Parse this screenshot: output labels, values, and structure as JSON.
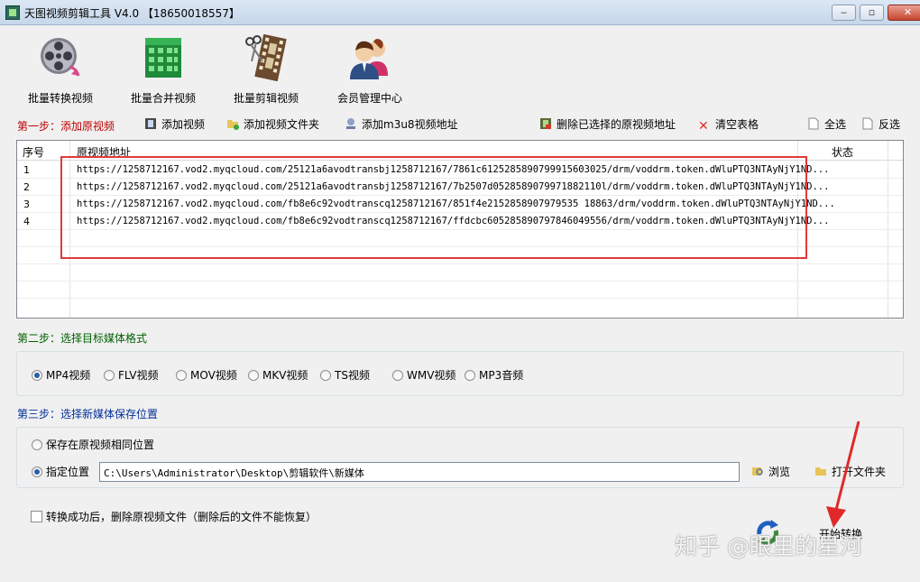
{
  "window": {
    "title": "天图视频剪辑工具 V4.0  【18650018557】",
    "min_label": "▭",
    "max_label": "□",
    "close_label": "✕"
  },
  "toolbar": {
    "items": [
      {
        "label": "批量转换视频",
        "icon": "film-reel-icon"
      },
      {
        "label": "批量合并视频",
        "icon": "building-grid-icon"
      },
      {
        "label": "批量剪辑视频",
        "icon": "film-scissors-icon"
      },
      {
        "label": "会员管理中心",
        "icon": "users-icon"
      }
    ]
  },
  "step1": {
    "label": "第一步：添加原视频",
    "add_video": "添加视频",
    "add_folder": "添加视频文件夹",
    "add_m3u8": "添加m3u8视频地址",
    "delete_selected": "删除已选择的原视频地址",
    "clear_table": "清空表格",
    "select_all": "全选",
    "invert": "反选"
  },
  "table": {
    "headers": {
      "index": "序号",
      "url": "原视频地址",
      "status": "状态"
    },
    "rows": [
      {
        "index": "1",
        "url": "https://1258712167.vod2.myqcloud.com/25121a6avodtransbj1258712167/7861c6125285890799915603025/drm/voddrm.token.dWluPTQ3NTAyNjY1ND..."
      },
      {
        "index": "2",
        "url": "https://1258712167.vod2.myqcloud.com/25121a6avodtransbj1258712167/7b2507d0528589079971882110l/drm/voddrm.token.dWluPTQ3NTAyNjY1ND..."
      },
      {
        "index": "3",
        "url": "https://1258712167.vod2.myqcloud.com/fb8e6c92vodtranscq1258712167/851f4e2152858907979535 18863/drm/voddrm.token.dWluPTQ3NTAyNjY1ND..."
      },
      {
        "index": "4",
        "url": "https://1258712167.vod2.myqcloud.com/fb8e6c92vodtranscq1258712167/ffdcbc605285890797846049556/drm/voddrm.token.dWluPTQ3NTAyNjY1ND..."
      }
    ]
  },
  "step2": {
    "label": "第二步：选择目标媒体格式",
    "formats": [
      {
        "label": "MP4视频",
        "selected": true
      },
      {
        "label": "FLV视频",
        "selected": false
      },
      {
        "label": "MOV视频",
        "selected": false
      },
      {
        "label": "MKV视频",
        "selected": false
      },
      {
        "label": "TS视频",
        "selected": false
      },
      {
        "label": "WMV视频",
        "selected": false
      },
      {
        "label": "MP3音频",
        "selected": false
      }
    ]
  },
  "step3": {
    "label": "第三步：选择新媒体保存位置",
    "same_location": "保存在原视频相同位置",
    "specify_location": "指定位置",
    "path_value": "C:\\Users\\Administrator\\Desktop\\剪辑软件\\新媒体",
    "browse": "浏览",
    "open_folder": "打开文件夹"
  },
  "options": {
    "delete_after": "转换成功后，删除原视频文件（删除后的文件不能恢复）"
  },
  "start": {
    "label": "开始转换"
  },
  "watermark": {
    "text": "知乎 @眼里的星河"
  },
  "colors": {
    "step1": "#c00000",
    "step2": "#006000",
    "step3": "#00309a",
    "highlight_box": "#e03a3a"
  }
}
